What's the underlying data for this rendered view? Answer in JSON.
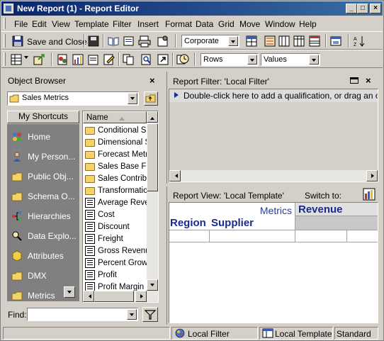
{
  "window": {
    "title": "New Report (1) - Report Editor",
    "buttons": [
      "_",
      "□",
      "×"
    ]
  },
  "menu": [
    "File",
    "Edit",
    "View",
    "Template",
    "Filter",
    "Insert",
    "Format",
    "Data",
    "Grid",
    "Move",
    "Window",
    "Help"
  ],
  "toolbar1": {
    "save_close_label": "Save and Close",
    "style_combo": "Corporate"
  },
  "toolbar2": {
    "rows_combo": "Rows",
    "values_combo": "Values"
  },
  "object_browser": {
    "title": "Object Browser",
    "folder_combo": "Sales Metrics",
    "shortcuts_header": "My Shortcuts",
    "shortcuts": [
      "Home",
      "My Person...",
      "Public Obj...",
      "Schema O...",
      "Hierarchies",
      "Data Explo...",
      "Attributes",
      "DMX",
      "Metrics"
    ],
    "list_header": "Name",
    "items": [
      {
        "label": "Conditional Sal",
        "kind": "folder"
      },
      {
        "label": "Dimensional Sa",
        "kind": "folder"
      },
      {
        "label": "Forecast Metric",
        "kind": "folder"
      },
      {
        "label": "Sales Base For",
        "kind": "folder"
      },
      {
        "label": "Sales Contribut",
        "kind": "folder"
      },
      {
        "label": "Transformation",
        "kind": "folder"
      },
      {
        "label": "Average Reven",
        "kind": "metric"
      },
      {
        "label": "Cost",
        "kind": "metric"
      },
      {
        "label": "Discount",
        "kind": "metric"
      },
      {
        "label": "Freight",
        "kind": "metric"
      },
      {
        "label": "Gross Revenue",
        "kind": "metric"
      },
      {
        "label": "Percent Growth",
        "kind": "metric"
      },
      {
        "label": "Profit",
        "kind": "metric"
      },
      {
        "label": "Profit Margin",
        "kind": "metric"
      }
    ],
    "find_label": "Find:"
  },
  "report_filter": {
    "title": "Report Filter: 'Local Filter'",
    "hint": "Double-click here to add a qualification, or drag an object"
  },
  "report_view": {
    "title": "Report View: 'Local Template'",
    "switch_label": "Switch to:",
    "metrics_label": "Metrics",
    "revenue_label": "Revenue",
    "region_label": "Region",
    "supplier_label": "Supplier"
  },
  "statusbar": {
    "filter": "Local Filter",
    "template": "Local Template",
    "mode": "Standard"
  }
}
